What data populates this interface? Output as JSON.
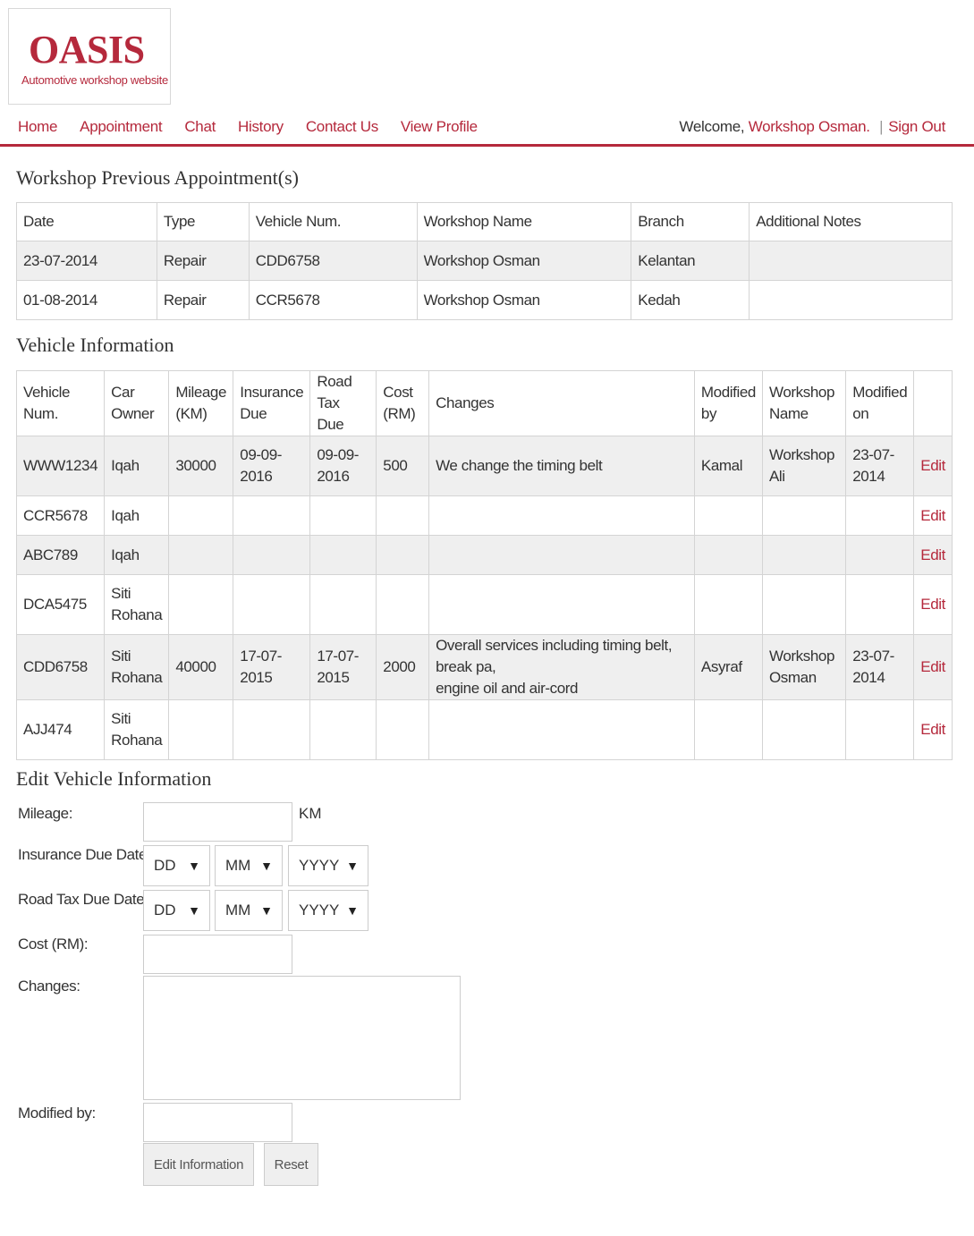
{
  "logo": {
    "title": "OASIS",
    "subtitle": "Automotive workshop website"
  },
  "nav": {
    "links": [
      "Home",
      "Appointment",
      "Chat",
      "History",
      "Contact Us",
      "View Profile"
    ],
    "welcome_prefix": "Welcome, ",
    "user_name": "Workshop Osman.",
    "separator": "|",
    "sign_out": "Sign Out"
  },
  "appointments": {
    "heading": "Workshop Previous Appointment(s)",
    "columns": [
      "Date",
      "Type",
      "Vehicle Num.",
      "Workshop Name",
      "Branch",
      "Additional Notes"
    ],
    "rows": [
      [
        "23-07-2014",
        "Repair",
        "CDD6758",
        "Workshop Osman",
        "Kelantan",
        ""
      ],
      [
        "01-08-2014",
        "Repair",
        "CCR5678",
        "Workshop Osman",
        "Kedah",
        ""
      ]
    ]
  },
  "vehicles": {
    "heading": "Vehicle Information",
    "columns": [
      [
        "Vehicle",
        "Num."
      ],
      [
        "Car",
        "Owner"
      ],
      [
        "Mileage",
        "(KM)"
      ],
      [
        "Insurance",
        "Due"
      ],
      [
        "Road Tax",
        "Due"
      ],
      [
        "Cost",
        "(RM)"
      ],
      [
        "Changes",
        ""
      ],
      [
        "Modified",
        "by"
      ],
      [
        "Workshop",
        "Name"
      ],
      [
        "Modified",
        "on"
      ],
      [
        "",
        ""
      ]
    ],
    "edit_label": "Edit",
    "rows": [
      [
        [
          "WWW1234"
        ],
        [
          "Iqah"
        ],
        [
          "30000"
        ],
        [
          "09-09-",
          "2016"
        ],
        [
          "09-09-",
          "2016"
        ],
        [
          "500"
        ],
        [
          "We change the timing belt"
        ],
        [
          "Kamal"
        ],
        [
          "Workshop",
          "Ali"
        ],
        [
          "23-07-",
          "2014"
        ]
      ],
      [
        [
          "CCR5678"
        ],
        [
          "Iqah"
        ],
        [
          ""
        ],
        [
          ""
        ],
        [
          ""
        ],
        [
          ""
        ],
        [
          ""
        ],
        [
          ""
        ],
        [
          ""
        ],
        [
          ""
        ]
      ],
      [
        [
          "ABC789"
        ],
        [
          "Iqah"
        ],
        [
          ""
        ],
        [
          ""
        ],
        [
          ""
        ],
        [
          ""
        ],
        [
          ""
        ],
        [
          ""
        ],
        [
          ""
        ],
        [
          ""
        ]
      ],
      [
        [
          "DCA5475"
        ],
        [
          "Siti",
          "Rohana"
        ],
        [
          ""
        ],
        [
          ""
        ],
        [
          ""
        ],
        [
          ""
        ],
        [
          ""
        ],
        [
          ""
        ],
        [
          ""
        ],
        [
          ""
        ]
      ],
      [
        [
          "CDD6758"
        ],
        [
          "Siti",
          "Rohana"
        ],
        [
          "40000"
        ],
        [
          "17-07-",
          "2015"
        ],
        [
          "17-07-",
          "2015"
        ],
        [
          "2000"
        ],
        [
          "Overall services including timing belt, break pa,",
          "engine oil and air-cord"
        ],
        [
          "Asyraf"
        ],
        [
          "Workshop",
          "Osman"
        ],
        [
          "23-07-",
          "2014"
        ]
      ],
      [
        [
          "AJJ474"
        ],
        [
          "Siti",
          "Rohana"
        ],
        [
          ""
        ],
        [
          ""
        ],
        [
          ""
        ],
        [
          ""
        ],
        [
          ""
        ],
        [
          ""
        ],
        [
          ""
        ],
        [
          ""
        ]
      ]
    ]
  },
  "edit_form": {
    "heading": "Edit Vehicle Information",
    "mileage_label": "Mileage:",
    "mileage_value": "",
    "mileage_unit": "KM",
    "insurance_label": "Insurance Due Date:",
    "roadtax_label": "Road Tax Due Date:",
    "day_placeholder": "DD",
    "month_placeholder": "MM",
    "year_placeholder": "YYYY",
    "cost_label": "Cost (RM):",
    "cost_value": "",
    "changes_label": "Changes:",
    "changes_value": "",
    "modified_by_label": "Modified by:",
    "modified_by_value": "",
    "submit_label": "Edit Information",
    "reset_label": "Reset"
  },
  "colors": {
    "accent": "#b5293c",
    "row_alt": "#efefef",
    "border": "#d4d4d4"
  }
}
